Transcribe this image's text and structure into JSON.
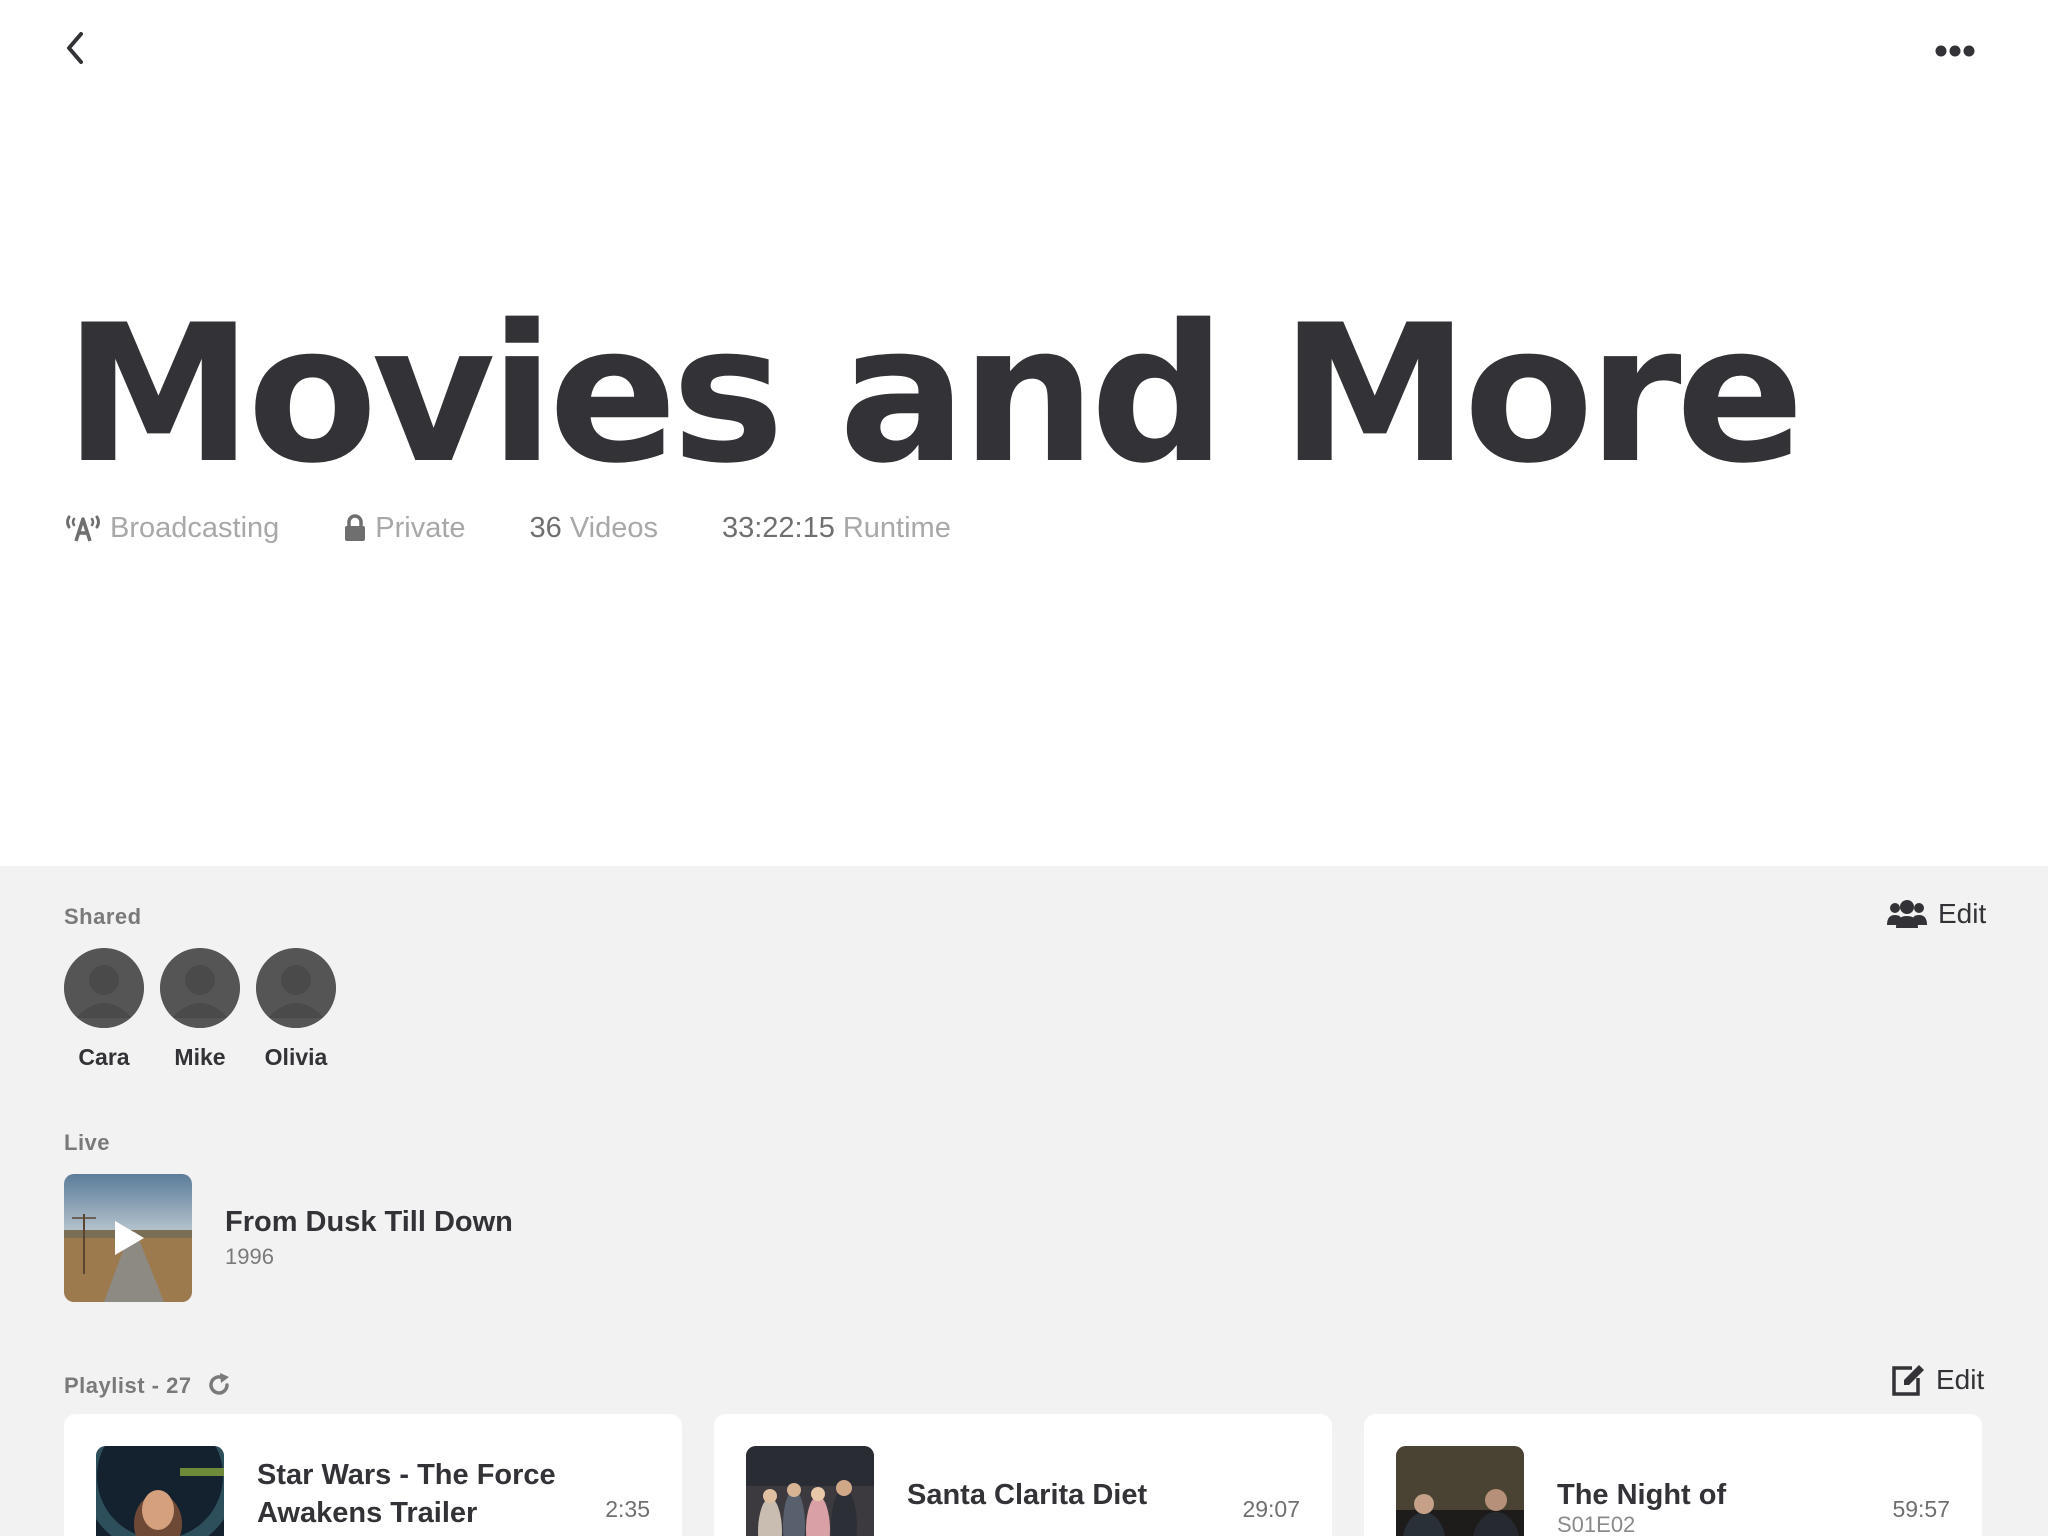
{
  "nav": {
    "back_icon": "chevron-left-icon",
    "more_icon": "ellipsis-icon"
  },
  "header": {
    "title": "Movies and More",
    "broadcast_label": "Broadcasting",
    "privacy_label": "Private",
    "videos_count": "36",
    "videos_label": "Videos",
    "runtime_value": "33:22:15",
    "runtime_label": "Runtime"
  },
  "shared": {
    "label": "Shared",
    "edit_label": "Edit",
    "users": [
      {
        "name": "Cara"
      },
      {
        "name": "Mike"
      },
      {
        "name": "Olivia"
      }
    ]
  },
  "live": {
    "label": "Live",
    "title": "From Dusk Till Down",
    "year": "1996"
  },
  "playlist": {
    "label": "Playlist - 27",
    "edit_label": "Edit",
    "items": [
      {
        "title": "Star Wars - The Force Awakens Trailer",
        "subtitle": "",
        "duration": "2:35"
      },
      {
        "title": "Santa Clarita Diet",
        "subtitle": "",
        "duration": "29:07"
      },
      {
        "title": "The Night of",
        "subtitle": "S01E02",
        "duration": "59:57"
      }
    ]
  },
  "colors": {
    "text": "#333236",
    "muted": "#a8a8a8",
    "panel_bg": "#f2f2f2",
    "card_bg": "#ffffff"
  }
}
